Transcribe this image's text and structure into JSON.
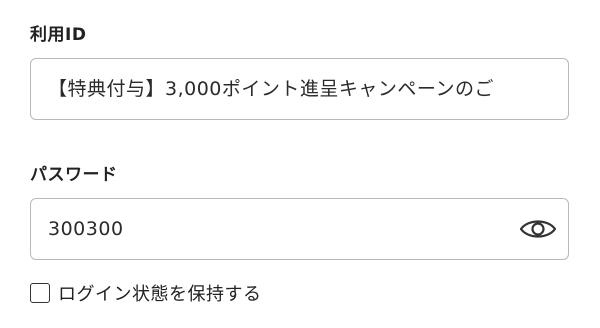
{
  "login_form": {
    "id_field": {
      "label": "利用ID",
      "value": "【特典付与】3,000ポイント進呈キャンペーンのご"
    },
    "password_field": {
      "label": "パスワード",
      "value": "300300",
      "toggle_icon": "eye-icon"
    },
    "remember_me": {
      "label": "ログイン状態を保持する",
      "checked": false
    }
  },
  "colors": {
    "border": "#b9b9b9",
    "text": "#222222",
    "background": "#ffffff"
  }
}
